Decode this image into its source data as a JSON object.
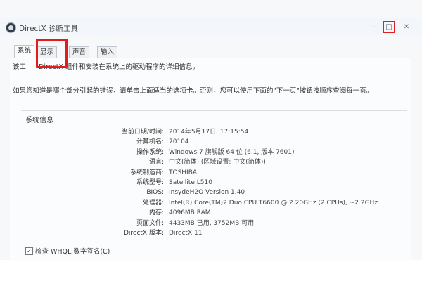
{
  "window": {
    "title": "DirectX 诊断工具",
    "min_glyph": "—",
    "max_glyph": "□",
    "close_glyph": "✕"
  },
  "tabs": [
    {
      "label": "系统",
      "active": true
    },
    {
      "label": "显示",
      "active": false,
      "highlighted": true
    },
    {
      "label": "声音",
      "active": false
    },
    {
      "label": "输入",
      "active": false
    }
  ],
  "intro": {
    "line1_lead": "该工",
    "line1_tail": "DirectX 组件和安装在系统上的驱动程序的详细信息。",
    "line2": "如果您知道是哪个部分引起的错误，请单击上面适当的选项卡。否则，您可以使用下面的\"下一页\"按钮按顺序查阅每一页。"
  },
  "system_info": {
    "title": "系统信息",
    "rows": [
      {
        "label": "当前日期/时间:",
        "value": "2014年5月17日, 17:15:54"
      },
      {
        "label": "计算机名:",
        "value": "70104"
      },
      {
        "label": "操作系统:",
        "value": "Windows 7 旗舰版 64 位 (6.1, 版本 7601)"
      },
      {
        "label": "语言:",
        "value": "中文(简体) (区域设置: 中文(简体))"
      },
      {
        "label": "系统制造商:",
        "value": "TOSHIBA"
      },
      {
        "label": "系统型号:",
        "value": "Satellite L510"
      },
      {
        "label": "BIOS:",
        "value": "InsydeH2O Version 1.40"
      },
      {
        "label": "处理器:",
        "value": "Intel(R) Core(TM)2 Duo CPU      T6600  @ 2.20GHz (2 CPUs), ~2.2GHz"
      },
      {
        "label": "内存:",
        "value": "4096MB RAM"
      },
      {
        "label": "页面文件:",
        "value": "4433MB 已用, 3752MB 可用"
      },
      {
        "label": "DirectX 版本:",
        "value": "DirectX 11"
      }
    ]
  },
  "whql": {
    "checked": true,
    "check_glyph": "✓",
    "label": "检查 WHQL 数字签名(C)"
  }
}
